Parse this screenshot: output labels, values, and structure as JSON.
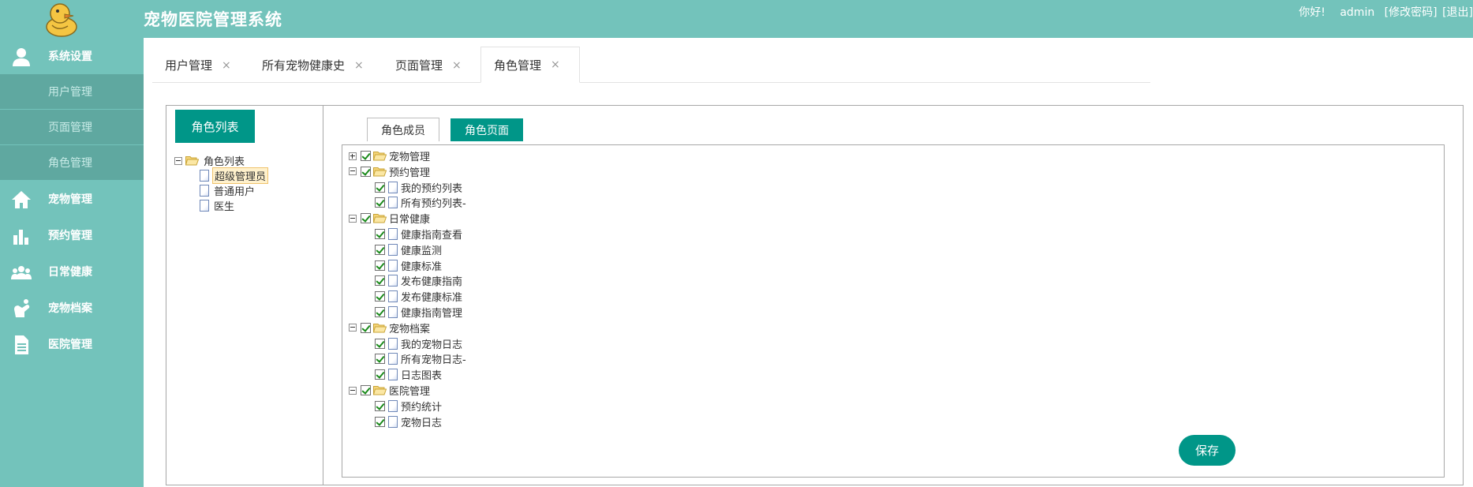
{
  "header": {
    "title": "宠物医院管理系统",
    "greeting": "你好!",
    "username": "admin",
    "change_password": "[修改密码]",
    "logout": "[退出]"
  },
  "sidebar": {
    "items": [
      {
        "label": "系统设置",
        "icon": "user-icon",
        "children": [
          {
            "label": "用户管理"
          },
          {
            "label": "页面管理"
          },
          {
            "label": "角色管理"
          }
        ]
      },
      {
        "label": "宠物管理",
        "icon": "home-icon"
      },
      {
        "label": "预约管理",
        "icon": "bar-chart-icon"
      },
      {
        "label": "日常健康",
        "icon": "people-icon"
      },
      {
        "label": "宠物档案",
        "icon": "pet-hand-icon"
      },
      {
        "label": "医院管理",
        "icon": "document-icon"
      }
    ]
  },
  "tabs": [
    {
      "label": "用户管理"
    },
    {
      "label": "所有宠物健康史"
    },
    {
      "label": "页面管理"
    },
    {
      "label": "角色管理",
      "active": true
    }
  ],
  "tab_close": "×",
  "left_panel": {
    "button": "角色列表",
    "tree_root": "角色列表",
    "roles": [
      {
        "label": "超级管理员",
        "selected": true
      },
      {
        "label": "普通用户"
      },
      {
        "label": "医生"
      }
    ]
  },
  "right_panel": {
    "sub_tabs": [
      {
        "label": "角色成员"
      },
      {
        "label": "角色页面",
        "active": true
      }
    ],
    "tree": [
      {
        "label": "宠物管理",
        "expanded": false,
        "checked": true,
        "children": []
      },
      {
        "label": "预约管理",
        "expanded": true,
        "checked": true,
        "children": [
          {
            "label": "我的预约列表",
            "checked": true
          },
          {
            "label": "所有预约列表-",
            "checked": true
          }
        ]
      },
      {
        "label": "日常健康",
        "expanded": true,
        "checked": true,
        "children": [
          {
            "label": "健康指南查看",
            "checked": true
          },
          {
            "label": "健康监测",
            "checked": true
          },
          {
            "label": "健康标准",
            "checked": true
          },
          {
            "label": "发布健康指南",
            "checked": true
          },
          {
            "label": "发布健康标准",
            "checked": true
          },
          {
            "label": "健康指南管理",
            "checked": true
          }
        ]
      },
      {
        "label": "宠物档案",
        "expanded": true,
        "checked": true,
        "children": [
          {
            "label": "我的宠物日志",
            "checked": true
          },
          {
            "label": "所有宠物日志-",
            "checked": true
          },
          {
            "label": "日志图表",
            "checked": true
          }
        ]
      },
      {
        "label": "医院管理",
        "expanded": true,
        "checked": true,
        "children": [
          {
            "label": "预约统计",
            "checked": true
          },
          {
            "label": "宠物日志",
            "checked": true
          }
        ]
      }
    ],
    "save_button": "保存"
  },
  "colors": {
    "header_bg": "#73c3bb",
    "sidebar_sub_bg": "#5fa8a0",
    "primary": "#009688"
  }
}
